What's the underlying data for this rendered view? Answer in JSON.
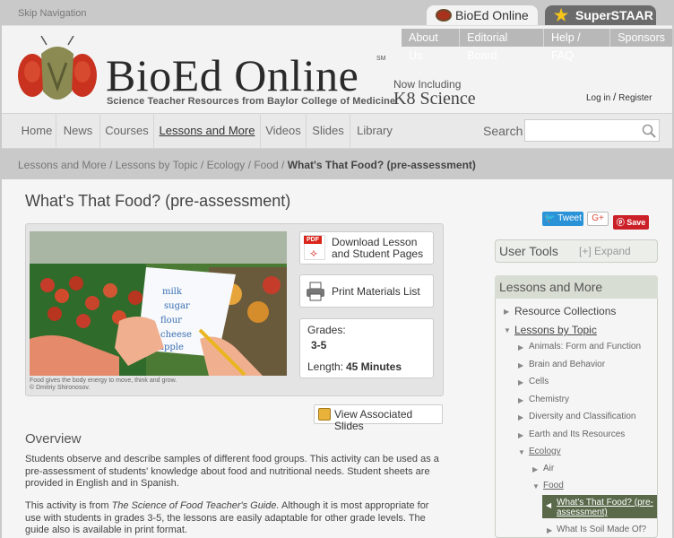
{
  "topbar": {
    "skip": "Skip Navigation"
  },
  "site_tabs": {
    "bioed": "BioEd Online",
    "staar": "SuperSTAAR"
  },
  "util_nav": [
    "About Us",
    "Editorial Board",
    "Help / FAQ",
    "Sponsors"
  ],
  "logo": {
    "name": "BioEd Online",
    "sm": "SM",
    "tagline": "Science Teacher Resources from Baylor College of Medicine",
    "now_including": "Now Including",
    "k8": "K8 Science"
  },
  "auth": {
    "login": "Log in",
    "sep": "/",
    "register": "Register"
  },
  "main_nav": [
    "Home",
    "News",
    "Courses",
    "Lessons and More",
    "Videos",
    "Slides",
    "Library"
  ],
  "search": {
    "label": "Search",
    "placeholder": ""
  },
  "breadcrumb": {
    "items": [
      "Lessons and More",
      "Lessons by Topic",
      "Ecology",
      "Food"
    ],
    "current": "What's That Food? (pre-assessment)"
  },
  "page": {
    "title": "What's That Food? (pre-assessment)"
  },
  "media": {
    "caption": "Food gives the body energy to move, think and grow.",
    "credit": "© Dmitriy Shironosov."
  },
  "resources": {
    "pdf_badge": "PDF",
    "download": "Download Lesson and Student Pages",
    "print": "Print Materials List",
    "grades_label": "Grades:",
    "grades": "3-5",
    "length_label": "Length:",
    "length": "45 Minutes",
    "slides_button": "View Associated Slides"
  },
  "social": {
    "tweet": "Tweet",
    "gplus": "G+",
    "save": "Save"
  },
  "overview": {
    "heading": "Overview",
    "p1": "Students observe and describe samples of different food groups. This activity can be used as a pre-assessment of students' knowledge about food and nutritional needs. Student sheets are provided in English and in Spanish.",
    "p2_a": "This activity is from ",
    "p2_book": "The Science of Food Teacher's Guide.",
    "p2_b": " Although it is most appropriate for use with students in grades 3-5, the lessons are easily adaptable for other grade levels. The guide also is available in print format."
  },
  "user_tools": {
    "title": "User Tools",
    "expand": "[+] Expand"
  },
  "lessons_panel": {
    "title": "Lessons and More",
    "resource_collections": "Resource Collections",
    "lessons_by_topic": "Lessons by Topic",
    "topics": [
      "Animals: Form and Function",
      "Brain and Behavior",
      "Cells",
      "Chemistry",
      "Diversity and Classification",
      "Earth and Its Resources"
    ],
    "ecology": "Ecology",
    "air": "Air",
    "food": "Food",
    "active": "What's That Food? (pre-assessment)",
    "next": "What Is Soil Made Of?"
  },
  "colors": {
    "accent_green": "#59694a",
    "tweet_blue": "#2a93d8",
    "pin_red": "#cb2027"
  }
}
